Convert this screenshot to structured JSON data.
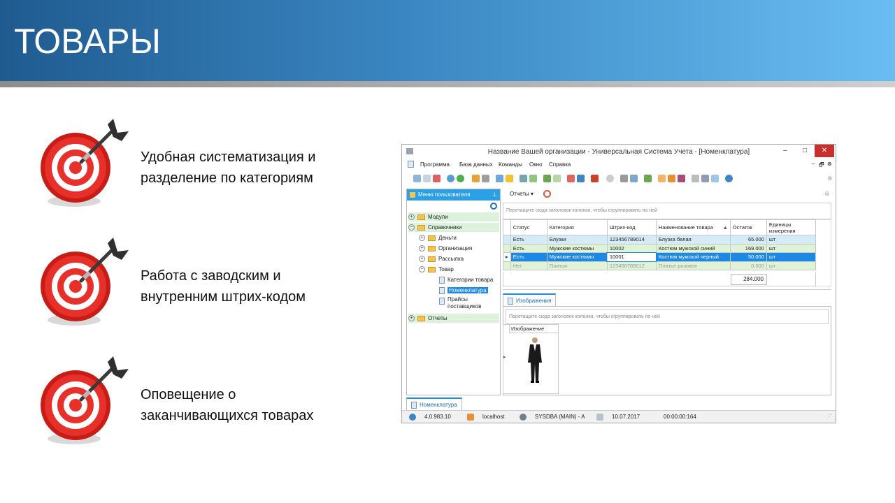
{
  "slide": {
    "title": "ТОВАРЫ",
    "bullets": [
      {
        "line1": "Удобная систематизация и",
        "line2": "разделение по категориям"
      },
      {
        "line1": "Работа с заводским и",
        "line2": "внутренним штрих-кодом"
      },
      {
        "line1": "Оповещение о",
        "line2": "заканчивающихся товарах"
      }
    ]
  },
  "app": {
    "window_title": "Название Вашей организации - Универсальная Система Учета - [Номенклатура]",
    "window_controls": {
      "minimize": "–",
      "maximize": "□",
      "close": "✕"
    },
    "menu": [
      "Программа",
      "База данных",
      "Команды",
      "Окно",
      "Справка"
    ],
    "mdi_controls": {
      "minimize": "–",
      "restore": "🗗",
      "close": "⊗"
    },
    "side_panel": {
      "title": "Меню пользователя",
      "items": [
        {
          "label": "Модули",
          "expander": "+"
        },
        {
          "label": "Справочники",
          "expander": "−"
        },
        {
          "label": "Деньги",
          "expander": "+"
        },
        {
          "label": "Организация",
          "expander": "+"
        },
        {
          "label": "Рассылка",
          "expander": "+"
        },
        {
          "label": "Товар",
          "expander": "−"
        },
        {
          "label": "Категории товара"
        },
        {
          "label": "Номенклатура"
        },
        {
          "label": "Прайсы поставщиков"
        },
        {
          "label": "Отчеты",
          "expander": "+"
        }
      ]
    },
    "reports_button": "Отчеты",
    "group_hint": "Перетащите сюда заголовок колонки, чтобы сгруппировать по ней",
    "grid": {
      "columns": [
        "Статус",
        "Категория",
        "Штрих-код",
        "Наименование товара",
        "Остаток",
        "Единицы измерения"
      ],
      "rows": [
        [
          "Есть",
          "Блузки",
          "123456789014",
          "Блузка белая",
          "65.000",
          "шт"
        ],
        [
          "Есть",
          "Мужские костюмы",
          "10002",
          "Костюм мужской синий",
          "169.000",
          "шт"
        ],
        [
          "Есть",
          "Мужские костюмы",
          "10001",
          "Костюм мужской черный",
          "50.000",
          "шт"
        ],
        [
          "Нет",
          "Платья",
          "123456789012",
          "Платье розовое",
          "0.000",
          "шт"
        ]
      ],
      "total": "284.000"
    },
    "detail_tab": "Изображения",
    "detail_group_hint": "Перетащите сюда заголовок колонки, чтобы сгруппировать по ней",
    "image_column": "Изображение",
    "bottom_tab": "Номенклатура",
    "status": {
      "version": "4.0.983.10",
      "host": "localhost",
      "user": "SYSDBA (MAIN) - A",
      "date": "10.07.2017",
      "timer": "00:00:00:164"
    }
  }
}
